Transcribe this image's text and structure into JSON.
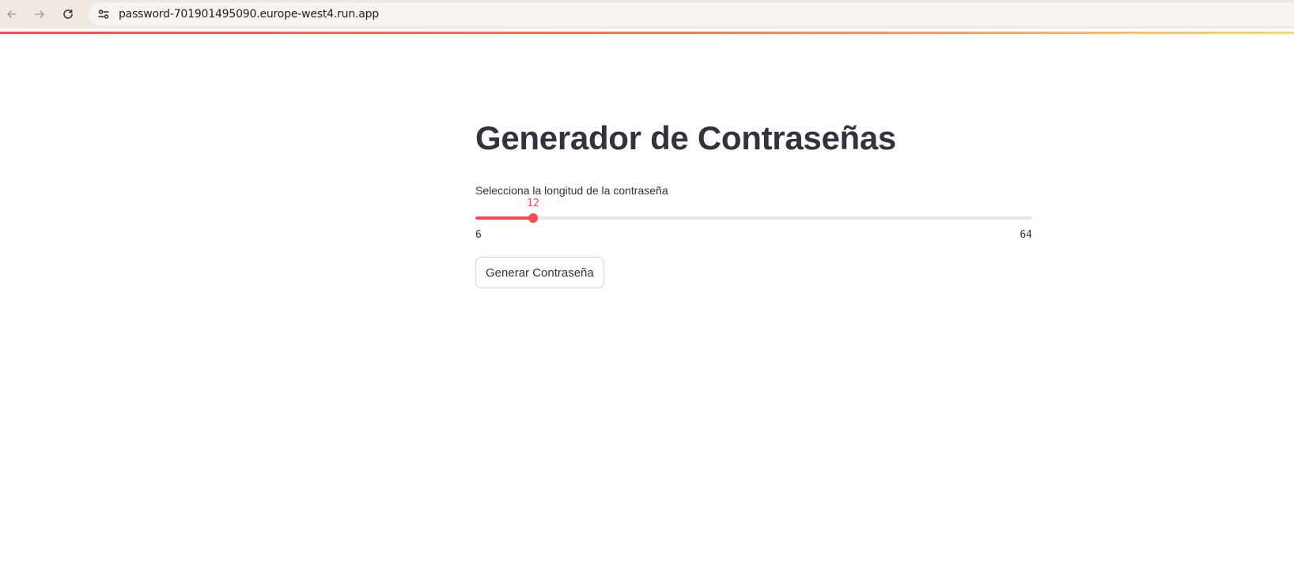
{
  "browser": {
    "url": "password-701901495090.europe-west4.run.app",
    "icons": {
      "back": "arrow-left-icon",
      "forward": "arrow-right-icon",
      "reload": "reload-icon",
      "site_info": "site-settings-icon"
    }
  },
  "page": {
    "title": "Generador de Contraseñas"
  },
  "slider": {
    "label": "Selecciona la longitud de la contraseña",
    "value": 12,
    "value_text": "12",
    "min": 6,
    "min_text": "6",
    "max": 64,
    "max_text": "64"
  },
  "button": {
    "generate_label": "Generar Contraseña"
  },
  "colors": {
    "accent": "#ff4b4b",
    "text": "#31333f",
    "track": "#e4e8ee"
  }
}
